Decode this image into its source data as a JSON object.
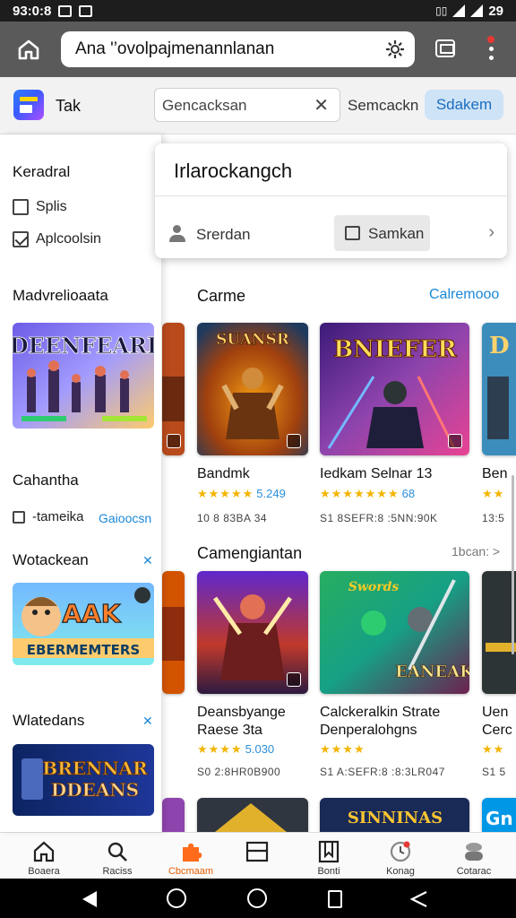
{
  "status_bar": {
    "time": "93:0:8",
    "right_text": "29"
  },
  "browser": {
    "address": "Ana '’ovolpajmenannlanan"
  },
  "header": {
    "title": "Tak",
    "search_value": "Gencacksan",
    "link": "Semcackn",
    "button": "Sdakem"
  },
  "dropdown": {
    "title": "Irlarockangch",
    "user": "Srerdan",
    "button": "Samkan"
  },
  "sidebar": {
    "heading1": "Keradral",
    "check1": "Splis",
    "check2": "Aplcoolsin",
    "heading2": "Madvrelioaata",
    "heading3": "Cahantha",
    "filter_label": "-tameika",
    "filter_link": "Gaioocsn",
    "heading4": "Wotackean",
    "heading5": "Wlatedans",
    "art2_text": "EBERMEMTERS",
    "art3_text": "DDEANS"
  },
  "sections": [
    {
      "title": "Carme",
      "link": "Calremooo"
    },
    {
      "title": "Camengiantan",
      "link": "1bcan: >"
    }
  ],
  "row1": [
    {
      "title": "Bandmk",
      "stars": "★★★★★",
      "num": "5.249",
      "meta": "10 8 83BA 34",
      "art": "SUANSR"
    },
    {
      "title": "Iedkam Selnar 13",
      "stars": "★★★★★★★",
      "num": "68",
      "meta": "S1 8SEFR:8 :5NN:90K",
      "art": "BNIEFER"
    },
    {
      "title": "Ben",
      "stars": "★★",
      "num": "",
      "meta": "13:5",
      "art": "D"
    }
  ],
  "row2": [
    {
      "title": "Deansbyange",
      "title2": "Raese 3ta",
      "stars": "★★★★",
      "num": "5.030",
      "meta": "S0 2:8HR0B900",
      "art": ""
    },
    {
      "title": "Calckeralkin Strate",
      "title2": "Denperalohgns",
      "stars": "★★★★",
      "num": "",
      "meta": "S1 A:SEFR:8 :8:3LR047",
      "art": "EANEAK"
    },
    {
      "title": "Uen",
      "title2": "Cerc",
      "stars": "★★",
      "num": "",
      "meta": "S1 5",
      "art": ""
    }
  ],
  "row3_art": [
    "",
    "SINNINAS",
    "Gn"
  ],
  "bottom_nav": [
    {
      "label": "Boaera",
      "icon": "home-icon"
    },
    {
      "label": "Raciss",
      "icon": "search-icon"
    },
    {
      "label": "Cbcmaam",
      "icon": "puzzle-icon"
    },
    {
      "label": "",
      "icon": "window-icon"
    },
    {
      "label": "Bonti",
      "icon": "library-icon"
    },
    {
      "label": "Konag",
      "icon": "clock-icon"
    },
    {
      "label": "Cotarac",
      "icon": "profile-icon"
    }
  ]
}
